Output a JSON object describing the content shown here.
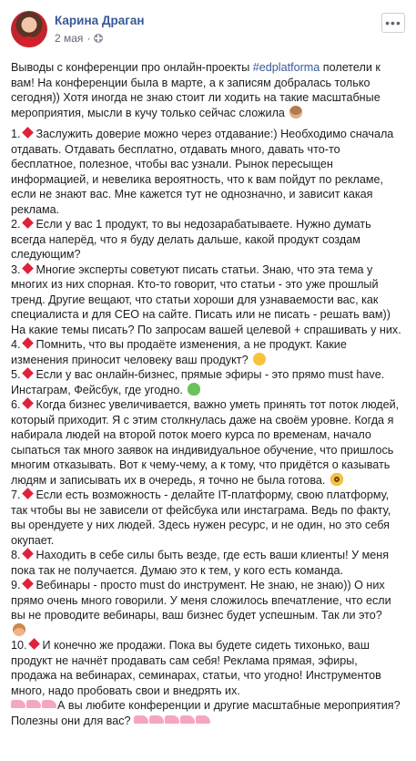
{
  "post": {
    "author": "Карина Драган",
    "date": "2 мая",
    "separator": "·",
    "more_label": "•••",
    "intro_pre": "Выводы с конференции про онлайн-проекты ",
    "hashtag": "#edplatforma",
    "intro_post": " полетели к вам! На конференции была в марте, а к записям добралась только сегодня)) Хотя иногда не знаю стоит ли ходить на такие масштабные мероприятия, мысли в кучу только сейчас сложила",
    "items": [
      {
        "num": "1.",
        "text": "Заслужить доверие можно через отдавание:) Необходимо сначала отдавать. Отдавать бесплатно, отдавать много, давать что-то бесплатное, полезное, чтобы вас узнали. Рынок пересыщен информацией, и невелика вероятность, что к вам пойдут по рекламе, если не знают вас. Мне кажется тут не однозначно, и зависит какая реклама."
      },
      {
        "num": "2.",
        "text": "Если у вас 1 продукт, то вы недозарабатываете. Нужно думать всегда наперёд, что я буду делать дальше, какой продукт создам следующим?"
      },
      {
        "num": "3.",
        "text": "Многие эксперты советуют писать статьи. Знаю, что эта тема у многих из них спорная. Кто-то говорит, что статьи - это уже прошлый тренд. Другие вещают, что статьи хороши для узнаваемости вас, как специалиста и для СЕО на сайте. Писать или не писать - решать вам)) На какие темы писать? По запросам вашей целевой + спрашивать у них."
      },
      {
        "num": "4.",
        "text": "Помнить, что вы продаёте изменения, а не продукт. Какие изменения приносит человеку ваш продукт?"
      },
      {
        "num": "5.",
        "text": "Если у вас онлайн-бизнес, прямые эфиры - это прямо must have. Инстаграм, Фейсбук, где угодно."
      },
      {
        "num": "6.",
        "text": "Когда бизнес увеличивается, важно уметь принять тот поток людей, который приходит. Я с этим столкнулась даже на своём уровне. Когда я набирала людей на второй поток моего курса по временам, начало сыпаться так много заявок на индивидуальное обучение, что пришлось многим отказывать. Вот к чему-чему, а к тому, что придётся о казывать людям и записывать их в очередь, я точно не была готова."
      },
      {
        "num": "7.",
        "text": "Если есть возможность - делайте IT-платформу, свою платформу, так чтобы вы не зависели от фейсбука или инстаграма. Ведь по факту, вы орендуете у них людей. Здесь нужен ресурс, и не один, но это себя окупает."
      },
      {
        "num": "8.",
        "text": "Находить в себе силы быть везде, где есть ваши клиенты! У меня пока так не получается. Думаю это к тем, у кого есть команда."
      },
      {
        "num": "9.",
        "text": "Вебинары - просто must do инструмент. Не знаю, не знаю)) О них прямо очень много говорили. У меня сложилось впечатление, что если вы не проводите вебинары, ваш бизнес будет успешным. Так ли это?"
      },
      {
        "num": "10.",
        "text": "И конечно же продажи. Пока вы будете сидеть тихонько, ваш продукт не начнёт продавать сам себя! Реклама прямая, эфиры, продажа на вебинарах, семинарах, статьи, что угодно! Инструментов много, надо пробовать свои и внедрять их."
      }
    ],
    "outro": "А вы любите конференции и другие масштабные мероприятия? Полезны они для вас?"
  },
  "colors": {
    "link": "#385898",
    "diamond": "#e0213a",
    "meta": "#616770"
  },
  "icons": [
    "avatar",
    "globe-icon",
    "more-icon",
    "diamond-icon",
    "monkey-emoji-icon",
    "thinking-emoji-icon",
    "green-heart-emoji-icon",
    "shocked-emoji-icon",
    "woman-emoji-icon",
    "shoe-emoji-icon"
  ]
}
